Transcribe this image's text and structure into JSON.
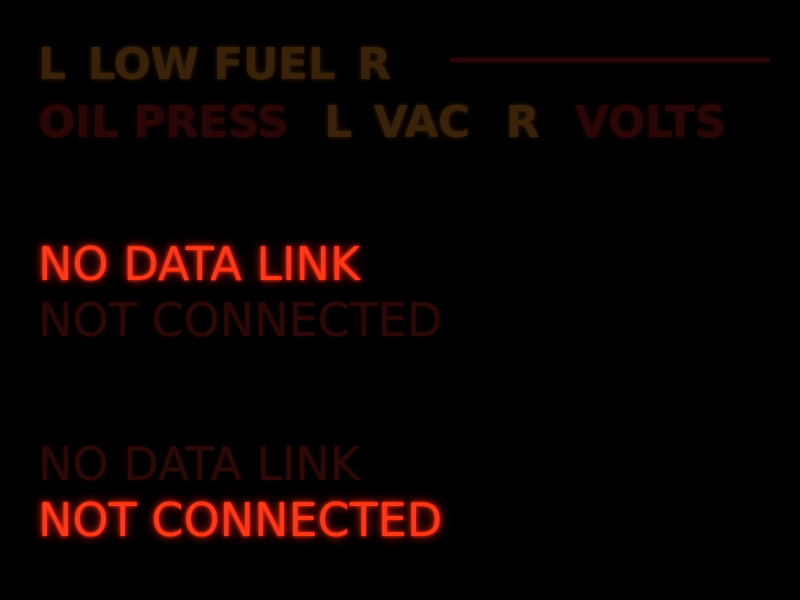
{
  "annunciators": {
    "row1": {
      "left_label": "L",
      "low_fuel_label": "LOW FUEL",
      "right_label": "R"
    },
    "row2": {
      "oil_press_label": "OIL PRESS",
      "left_label": "L",
      "vac_label": "VAC",
      "right_label": "R",
      "volts_label": "VOLTS"
    }
  },
  "status_blocks": [
    {
      "line1": "NO DATA LINK",
      "line2": "NOT CONNECTED",
      "active_line": 1
    },
    {
      "line1": "NO DATA LINK",
      "line2": "NOT CONNECTED",
      "active_line": 2
    }
  ],
  "colors": {
    "background": "#000000",
    "active_warning": "#ff3818",
    "dim_amber": "#3a2208",
    "dim_red": "#2a0706"
  }
}
